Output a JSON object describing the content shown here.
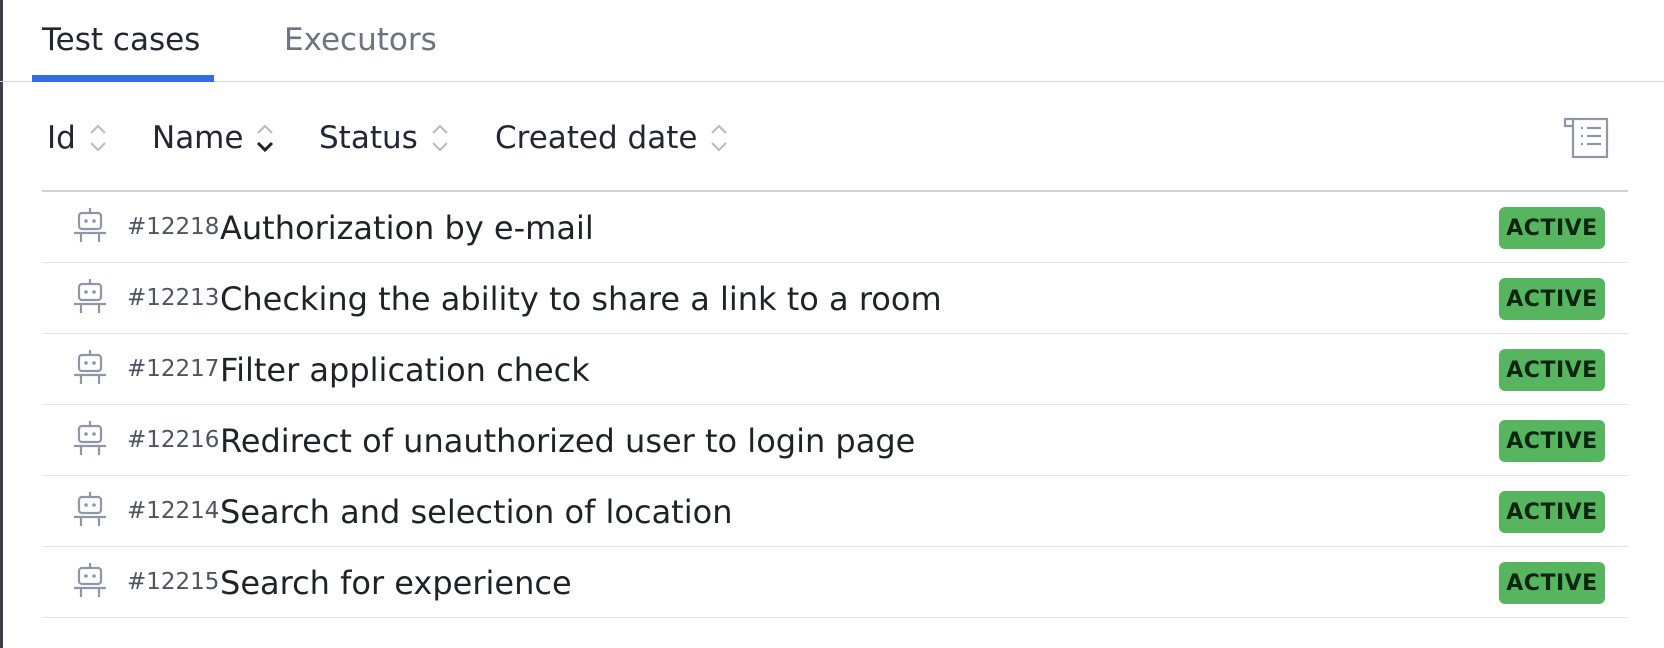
{
  "tabs": [
    {
      "label": "Test cases",
      "active": true
    },
    {
      "label": "Executors",
      "active": false
    }
  ],
  "columns": {
    "id": "Id",
    "name": "Name",
    "status": "Status",
    "created_date": "Created date",
    "sorted_by": "Name",
    "sort_direction": "descending"
  },
  "rows": [
    {
      "id": "#12218",
      "name": "Authorization by e-mail",
      "status": "ACTIVE"
    },
    {
      "id": "#12213",
      "name": "Checking the ability to share a link to a room",
      "status": "ACTIVE"
    },
    {
      "id": "#12217",
      "name": "Filter application check",
      "status": "ACTIVE"
    },
    {
      "id": "#12216",
      "name": "Redirect of unauthorized user to login page",
      "status": "ACTIVE"
    },
    {
      "id": "#12214",
      "name": "Search and selection of location",
      "status": "ACTIVE"
    },
    {
      "id": "#12215",
      "name": "Search for experience",
      "status": "ACTIVE"
    }
  ],
  "icons": {
    "row_icon": "robot-icon",
    "settings": "column-settings-icon"
  },
  "colors": {
    "accent": "#2f6ee0",
    "status_active": "#56b55e"
  }
}
